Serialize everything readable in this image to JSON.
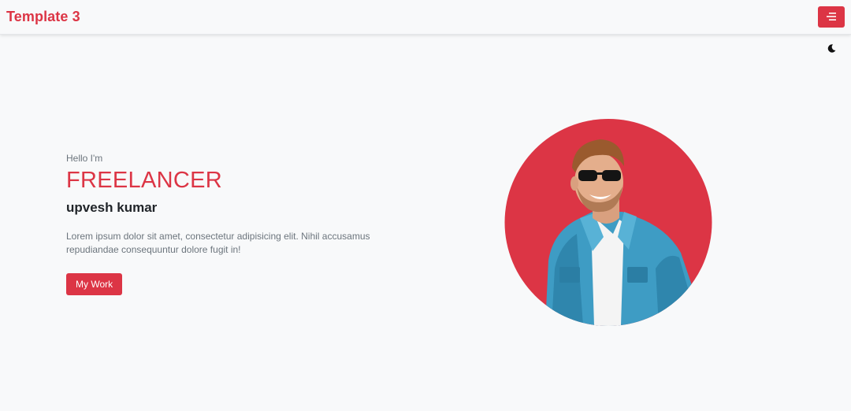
{
  "navbar": {
    "brand": "Template 3",
    "menu_icon": "menu-lines-icon"
  },
  "theme_toggle": {
    "icon": "moon-icon"
  },
  "hero": {
    "greeting": "Hello I'm",
    "role": "FREELANCER",
    "name": "upvesh kumar",
    "description": "Lorem ipsum dolor sit amet, consectetur adipisicing elit. Nihil accusamus repudiandae consequuntur dolore fugit in!",
    "button_label": "My Work"
  },
  "colors": {
    "accent": "#dc3545",
    "background": "#f8f9fa",
    "muted_text": "#6c757d",
    "dark_text": "#212529"
  }
}
